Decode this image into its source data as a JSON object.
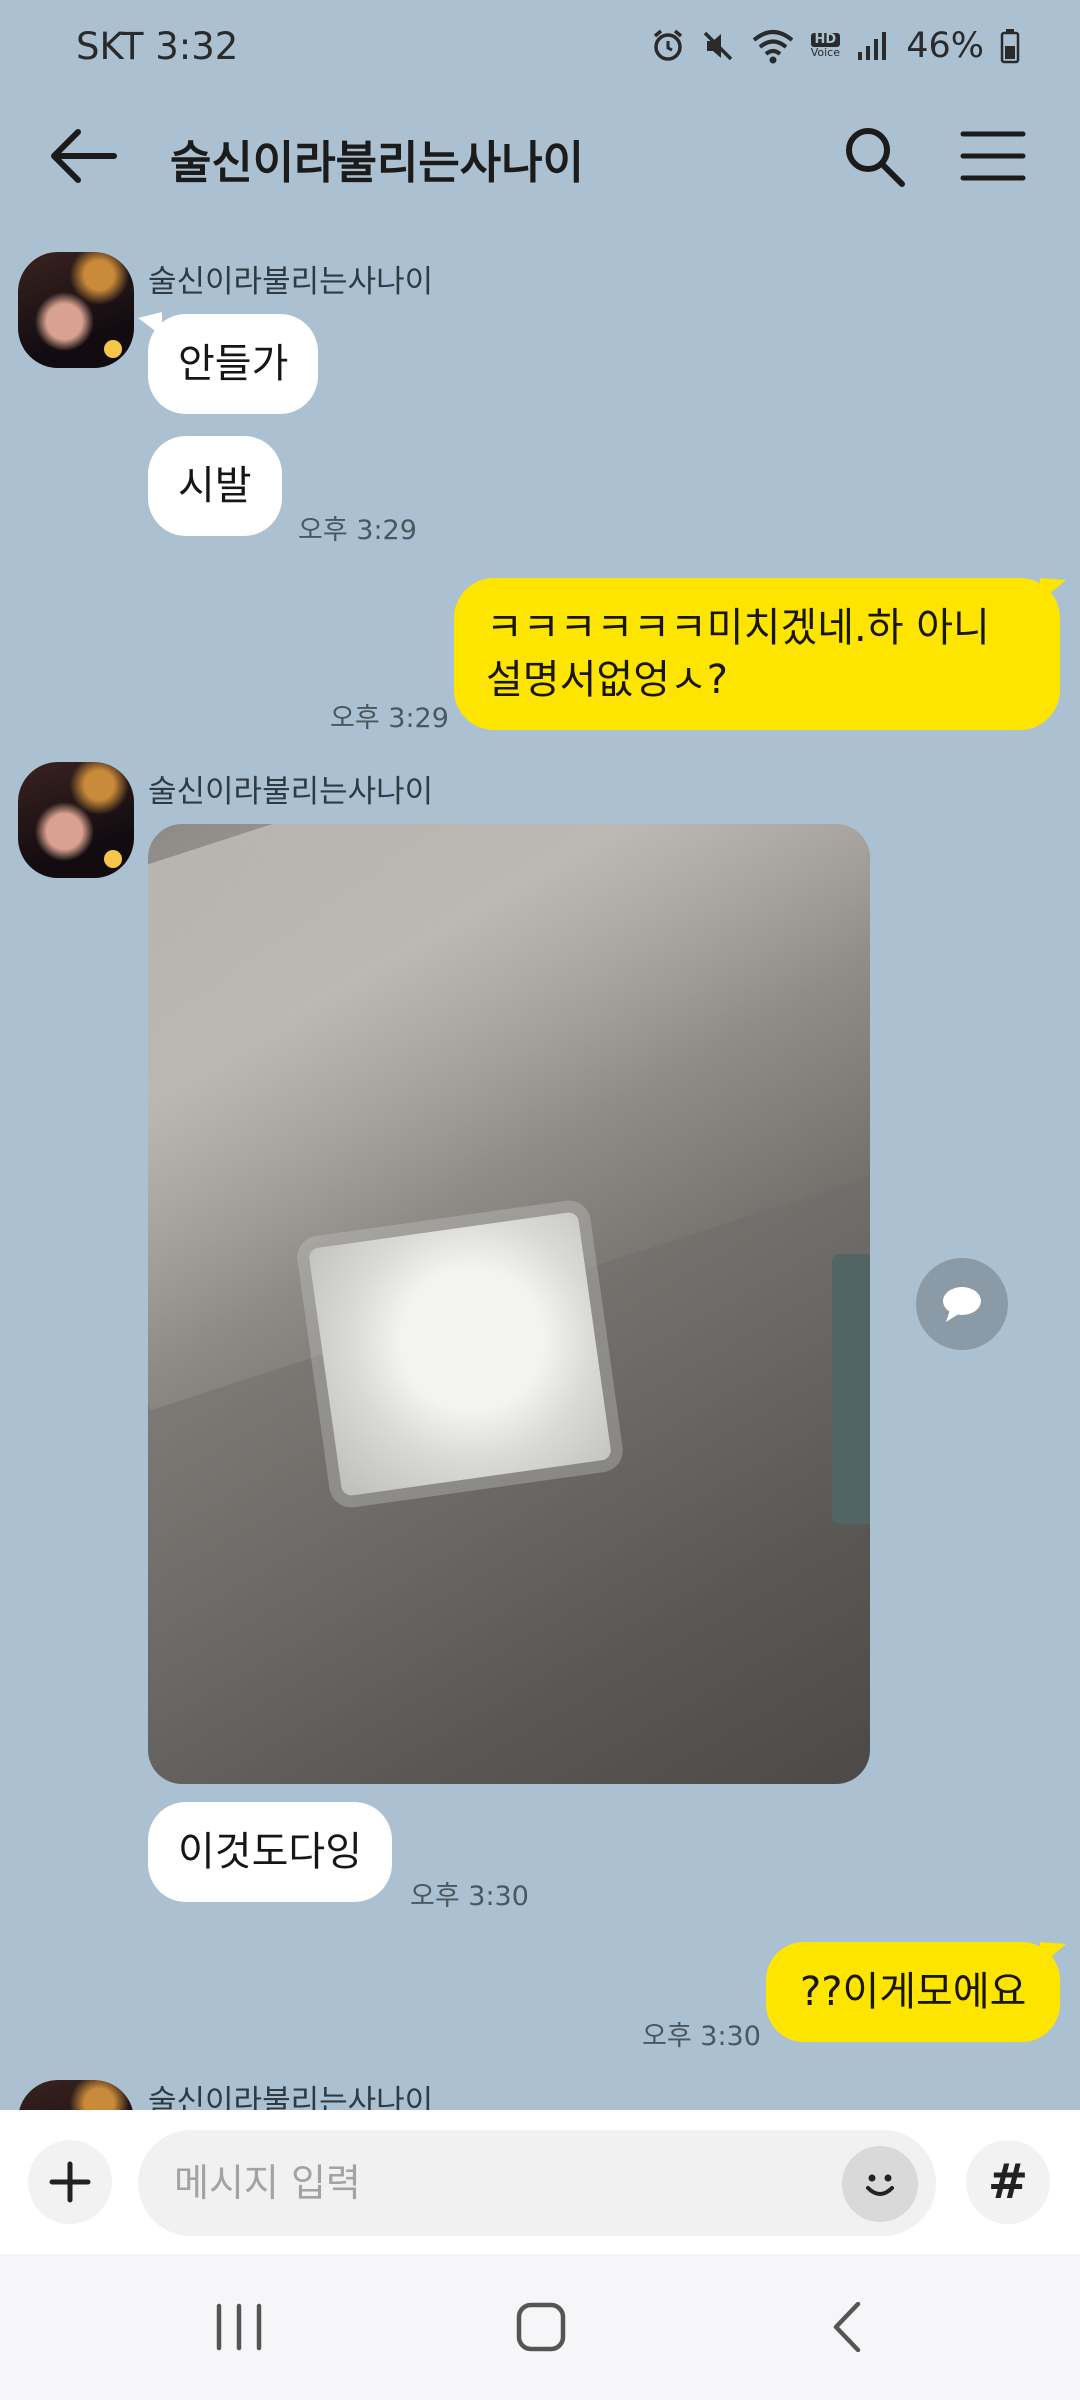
{
  "status_bar": {
    "carrier_time": "SKT 3:32",
    "battery": "46%",
    "hd_label": "HD",
    "voice_label": "Voice"
  },
  "header": {
    "title": "술신이라불리는사나이",
    "icons": [
      "back-arrow-icon",
      "search-icon",
      "menu-icon"
    ]
  },
  "messages": [
    {
      "sender": "술신이라불리는사나이",
      "text": "안들가",
      "direction": "incoming"
    },
    {
      "text": "시발",
      "direction": "incoming",
      "time": "오후 3:29"
    },
    {
      "text": "ㅋㅋㅋㅋㅋㅋ미치겠네.하 아니 설명서없엉ㅅ?",
      "direction": "outgoing",
      "time": "오후 3:29"
    },
    {
      "sender": "술신이라불리는사나이",
      "type": "photo",
      "direction": "incoming"
    },
    {
      "text": "이것도다잉",
      "direction": "incoming",
      "time": "오후 3:30"
    },
    {
      "text": "??이게모에요",
      "direction": "outgoing",
      "time": "오후 3:30"
    },
    {
      "sender": "술신이라불리는사나이",
      "direction": "incoming",
      "partially_visible": true
    }
  ],
  "input_bar": {
    "placeholder": "메시지 입력",
    "hash_label": "#"
  },
  "colors": {
    "background": "#abc1d1",
    "outgoing_bubble": "#fee500",
    "incoming_bubble": "#ffffff"
  }
}
